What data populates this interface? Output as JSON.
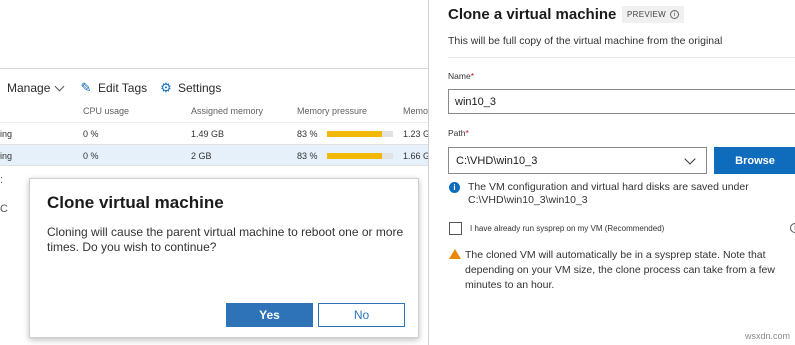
{
  "toolbar": {
    "manage_label": "Manage",
    "edit_tags_label": "Edit Tags",
    "settings_label": "Settings"
  },
  "vm_table": {
    "columns": [
      "CPU usage",
      "Assigned memory",
      "Memory pressure",
      "Memo"
    ],
    "rows": [
      {
        "state": "ing",
        "cpu": "0 %",
        "memory": "1.49 GB",
        "pressure": "83 %",
        "pressure_fraction": 0.83,
        "demand": "1.23 G"
      },
      {
        "state": "ing",
        "cpu": "0 %",
        "memory": "2 GB",
        "pressure": "83 %",
        "pressure_fraction": 0.83,
        "demand": "1.66 G"
      }
    ]
  },
  "dialog": {
    "title": "Clone virtual machine",
    "message": "Cloning will cause the parent virtual machine to reboot one or more times. Do you wish to continue?",
    "yes_label": "Yes",
    "no_label": "No"
  },
  "blade": {
    "title": "Clone a virtual machine",
    "preview_badge": "PREVIEW",
    "subtitle": "This will be full copy of the virtual machine from the original",
    "name_label": "Name",
    "name_value": "win10_3",
    "path_label": "Path",
    "path_value": "C:\\VHD\\win10_3",
    "browse_label": "Browse",
    "info_text": "The VM configuration and virtual hard disks are saved under C:\\VHD\\win10_3\\win10_3",
    "sysprep_label": "I have already run sysprep on my VM (Recommended)",
    "sysprep_checked": false,
    "warning_text": "The cloned VM will automatically be in a sysprep state. Note that depending on your VM size, the clone process can take from a few minutes to an hour."
  },
  "colors": {
    "accent": "#0f6cbd",
    "dialog_accent": "#2e73b8",
    "pressure_bar": "#f2b807",
    "warning": "#e8890c",
    "required": "#c50f1f"
  },
  "watermark": "wsxdn.com"
}
